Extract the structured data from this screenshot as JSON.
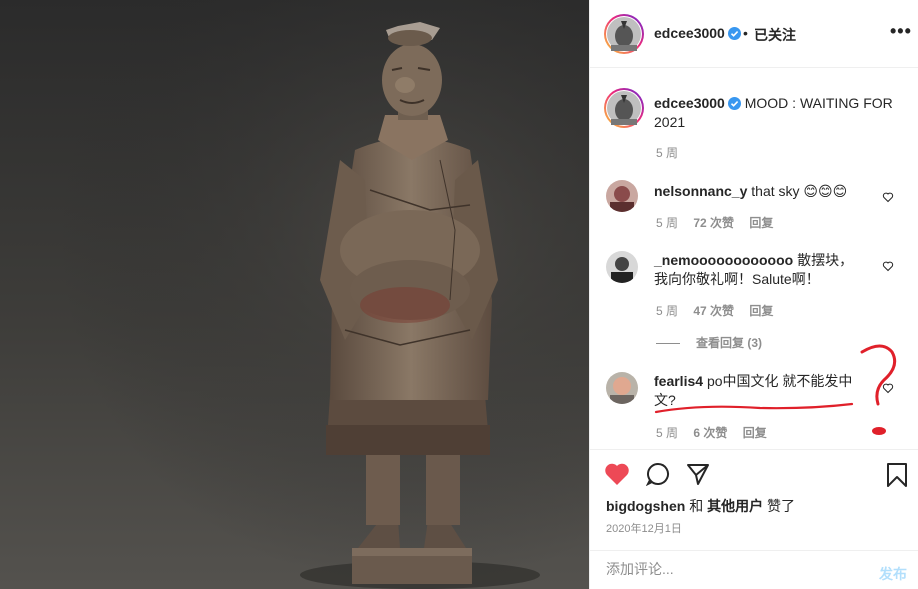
{
  "post": {
    "author": "edcee3000",
    "follow_status": "已关注",
    "separator": "•",
    "more_icon": "more-horizontal-icon",
    "caption": "MOOD : WAITING FOR 2021",
    "caption_time": "5 周"
  },
  "comments": [
    {
      "user": "nelsonnanc_y",
      "text": "that sky 😊😊😊",
      "time": "5 周",
      "likes": "72 次赞",
      "reply": "回复"
    },
    {
      "user": "_nemoooooooooooo",
      "text": "散摆块，我向你敬礼啊！Salute啊！",
      "time": "5 周",
      "likes": "47 次赞",
      "reply": "回复",
      "view_replies": "查看回复 (3)"
    },
    {
      "user": "fearlis4",
      "text": "po中国文化 就不能发中文?",
      "time": "5 周",
      "likes": "6 次赞",
      "reply": "回复"
    }
  ],
  "actions": {
    "liked_by_user": "bigdogshen",
    "liked_by_and": "和",
    "liked_by_others": "其他用户",
    "liked_by_suffix": "赞了",
    "date": "2020年12月1日"
  },
  "composer": {
    "placeholder": "添加评论...",
    "post_label": "发布"
  },
  "colors": {
    "like_red": "#ed4956",
    "verified_blue": "#3897f0",
    "annotation_red": "#e0202a",
    "post_disabled": "#b2dffc"
  }
}
